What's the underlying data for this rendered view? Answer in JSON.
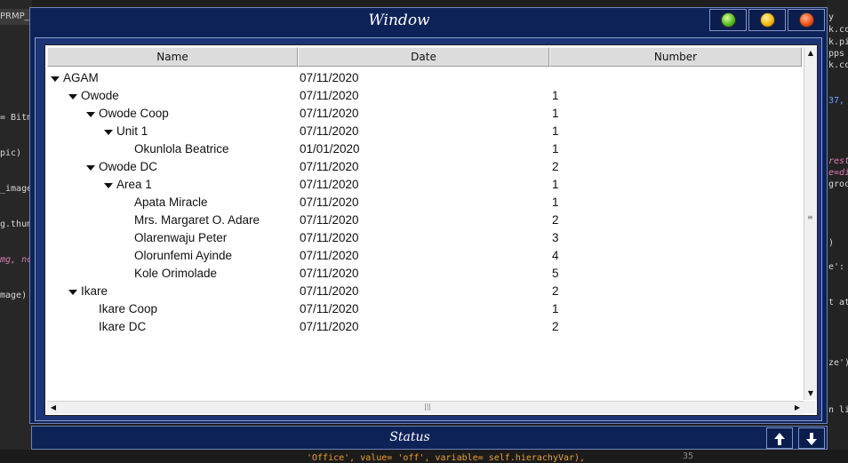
{
  "window": {
    "title": "Window"
  },
  "columns": [
    "Name",
    "Date",
    "Number"
  ],
  "rows": [
    {
      "name": "AGAM",
      "date": "07/11/2020",
      "number": "",
      "depth": 0,
      "expanded": true
    },
    {
      "name": "Owode",
      "date": "07/11/2020",
      "number": "1",
      "depth": 1,
      "expanded": true
    },
    {
      "name": "Owode Coop",
      "date": "07/11/2020",
      "number": "1",
      "depth": 2,
      "expanded": true
    },
    {
      "name": "Unit 1",
      "date": "07/11/2020",
      "number": "1",
      "depth": 3,
      "expanded": true
    },
    {
      "name": "Okunlola Beatrice",
      "date": "01/01/2020",
      "number": "1",
      "depth": 4,
      "expanded": false
    },
    {
      "name": "Owode DC",
      "date": "07/11/2020",
      "number": "2",
      "depth": 2,
      "expanded": true
    },
    {
      "name": "Area 1",
      "date": "07/11/2020",
      "number": "1",
      "depth": 3,
      "expanded": true
    },
    {
      "name": "Apata Miracle",
      "date": "07/11/2020",
      "number": "1",
      "depth": 4,
      "expanded": false
    },
    {
      "name": "Mrs. Margaret O. Adare",
      "date": "07/11/2020",
      "number": "2",
      "depth": 4,
      "expanded": false
    },
    {
      "name": "Olarenwaju Peter",
      "date": "07/11/2020",
      "number": "3",
      "depth": 4,
      "expanded": false
    },
    {
      "name": "Olorunfemi Ayinde",
      "date": "07/11/2020",
      "number": "4",
      "depth": 4,
      "expanded": false
    },
    {
      "name": "Kole Orimolade",
      "date": "07/11/2020",
      "number": "5",
      "depth": 4,
      "expanded": false
    },
    {
      "name": "Ikare",
      "date": "07/11/2020",
      "number": "2",
      "depth": 1,
      "expanded": true
    },
    {
      "name": "Ikare Coop",
      "date": "07/11/2020",
      "number": "1",
      "depth": 2,
      "expanded": false
    },
    {
      "name": "Ikare DC",
      "date": "07/11/2020",
      "number": "2",
      "depth": 2,
      "expanded": false
    }
  ],
  "statusbar": {
    "label": "Status"
  },
  "background": {
    "tab_label": "PRMP_I",
    "left_snippets": [
      "= Bitm",
      "pic)",
      "_image",
      "g.thum",
      "mg, nc",
      "mage)"
    ],
    "right_snippets": [
      "y",
      "k.cc",
      "k.pi",
      "pps",
      "k.cc",
      "37,",
      "rest",
      "e=di",
      "groc",
      ")",
      "e':",
      "t at",
      "ze')",
      "n li"
    ],
    "bottom_snippet": "'Office', value= 'off', variable= self.hierachyVar),",
    "line_number": "35"
  },
  "colors": {
    "window_bg": "#0d2358",
    "panel_bg": "#ffffff",
    "header_bg": "#dcdcdc",
    "btn_green": "#4fb81a",
    "btn_yellow": "#f0b400",
    "btn_red": "#f24a12"
  },
  "icons": [
    "expand-triangle-icon",
    "scroll-up-icon",
    "scroll-down-icon",
    "scroll-left-icon",
    "scroll-right-icon",
    "arrow-up-icon",
    "arrow-down-icon"
  ]
}
